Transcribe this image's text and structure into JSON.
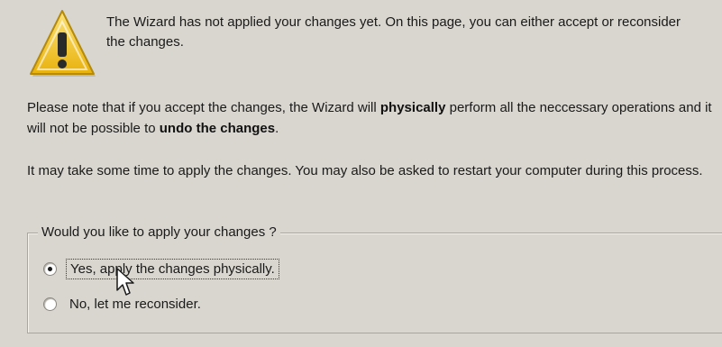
{
  "intro_text": "The Wizard has not applied your changes yet. On this page, you can either accept or reconsider the changes.",
  "note": {
    "part1": "Please note that if you accept the changes, the Wizard will ",
    "bold1": "physically",
    "part2": " perform all the neccessary operations and it will not be possible to ",
    "bold2": "undo the changes",
    "part3": "."
  },
  "time_text": "It may take some time to apply the changes. You may also be asked to restart your computer during this process.",
  "group": {
    "legend": "Would you like to apply your changes ?",
    "options": [
      {
        "label": "Yes, apply the changes physically.",
        "selected": true
      },
      {
        "label": "No, let me reconsider.",
        "selected": false
      }
    ]
  },
  "icons": {
    "warning": "warning-triangle-icon",
    "cursor": "mouse-pointer-icon"
  },
  "colors": {
    "background": "#d9d6cf",
    "warning_yellow": "#f2c21a"
  }
}
